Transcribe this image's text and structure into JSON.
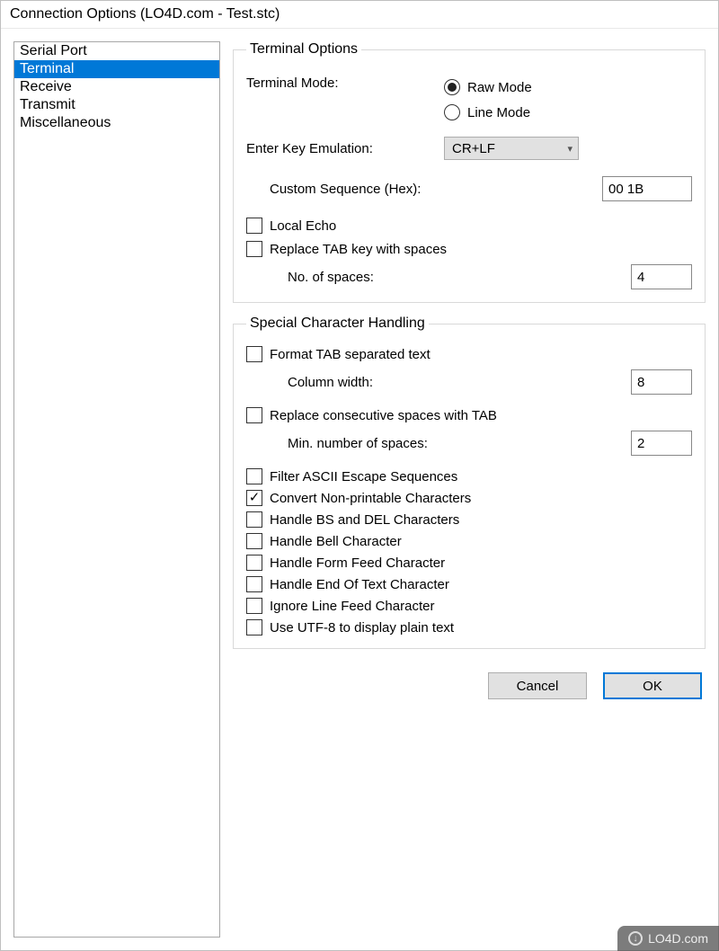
{
  "window": {
    "title": "Connection Options (LO4D.com - Test.stc)"
  },
  "sidebar": {
    "items": [
      {
        "label": "Serial Port",
        "selected": false
      },
      {
        "label": "Terminal",
        "selected": true
      },
      {
        "label": "Receive",
        "selected": false
      },
      {
        "label": "Transmit",
        "selected": false
      },
      {
        "label": "Miscellaneous",
        "selected": false
      }
    ]
  },
  "terminal_options": {
    "legend": "Terminal Options",
    "mode_label": "Terminal Mode:",
    "mode_options": {
      "raw": {
        "label": "Raw Mode",
        "checked": true
      },
      "line": {
        "label": "Line Mode",
        "checked": false
      }
    },
    "enter_key_label": "Enter Key Emulation:",
    "enter_key_value": "CR+LF",
    "custom_seq_label": "Custom Sequence (Hex):",
    "custom_seq_value": "00 1B",
    "local_echo": {
      "label": "Local Echo",
      "checked": false
    },
    "replace_tab": {
      "label": "Replace TAB key with spaces",
      "checked": false
    },
    "num_spaces_label": "No. of spaces:",
    "num_spaces_value": "4"
  },
  "special_char": {
    "legend": "Special Character Handling",
    "format_tab": {
      "label": "Format TAB separated text",
      "checked": false
    },
    "col_width_label": "Column width:",
    "col_width_value": "8",
    "replace_spaces": {
      "label": "Replace consecutive spaces with TAB",
      "checked": false
    },
    "min_spaces_label": "Min. number of spaces:",
    "min_spaces_value": "2",
    "filter_escape": {
      "label": "Filter ASCII Escape Sequences",
      "checked": false
    },
    "convert_np": {
      "label": "Convert Non-printable Characters",
      "checked": true
    },
    "handle_bs": {
      "label": "Handle BS and DEL Characters",
      "checked": false
    },
    "handle_bell": {
      "label": "Handle Bell Character",
      "checked": false
    },
    "handle_ff": {
      "label": "Handle Form Feed Character",
      "checked": false
    },
    "handle_eot": {
      "label": "Handle End Of Text Character",
      "checked": false
    },
    "ignore_lf": {
      "label": "Ignore Line Feed Character",
      "checked": false
    },
    "use_utf8": {
      "label": "Use UTF-8 to display plain text",
      "checked": false
    }
  },
  "buttons": {
    "cancel": "Cancel",
    "ok": "OK"
  },
  "watermark": "LO4D.com"
}
